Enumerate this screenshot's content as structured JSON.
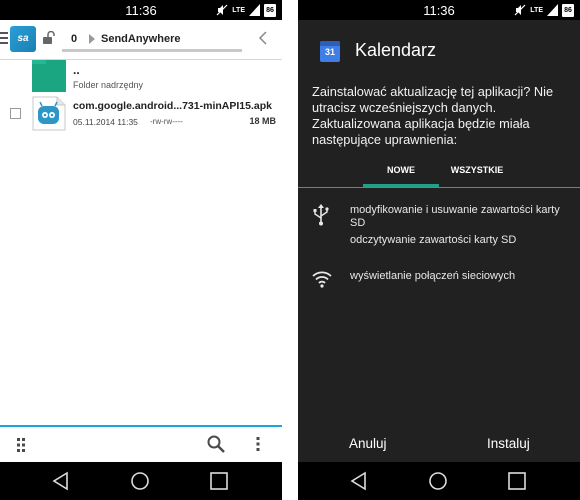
{
  "left": {
    "status": {
      "time": "11:36",
      "network": "LTE",
      "battery": "86"
    },
    "toolbar": {
      "breadcrumb_count": "0",
      "breadcrumb_label": "SendAnywhere",
      "app_icon_text": "sa"
    },
    "files": [
      {
        "name": "..",
        "subtitle": "Folder nadrzędny",
        "icon": "folder-icon"
      },
      {
        "name": "com.google.android...731-minAPI15.apk",
        "date": "05.11.2014 11:35",
        "permissions": "-rw-rw----",
        "size": "18 MB",
        "icon": "android-apk-icon"
      }
    ],
    "bottombar": {
      "icons": [
        "grip-icon",
        "search-icon",
        "more-vert-icon"
      ]
    }
  },
  "right": {
    "status": {
      "time": "11:36",
      "network": "LTE",
      "battery": "86"
    },
    "dialog": {
      "app_name": "Kalendarz",
      "app_icon_number": "31",
      "message": "Zainstalować aktualizację tej aplikacji? Nie utracisz wcześniejszych danych. Zaktualizowana aplikacja będzie miała następujące uprawnienia:",
      "tabs": [
        {
          "label": "NOWE",
          "selected": true
        },
        {
          "label": "WSZYSTKIE",
          "selected": false
        }
      ],
      "permissions": [
        {
          "icon": "usb-icon",
          "items": [
            "modyfikowanie i usuwanie zawartości karty SD",
            "odczytywanie zawartości karty SD"
          ]
        },
        {
          "icon": "wifi-icon",
          "items": [
            "wyświetlanie połączeń sieciowych"
          ]
        }
      ],
      "buttons": {
        "cancel": "Anuluj",
        "install": "Instaluj"
      }
    }
  },
  "colors": {
    "accent_blue": "#19a7d9",
    "teal": "#20a089",
    "folder_green": "#19a680",
    "dialog_bg": "#212121"
  }
}
